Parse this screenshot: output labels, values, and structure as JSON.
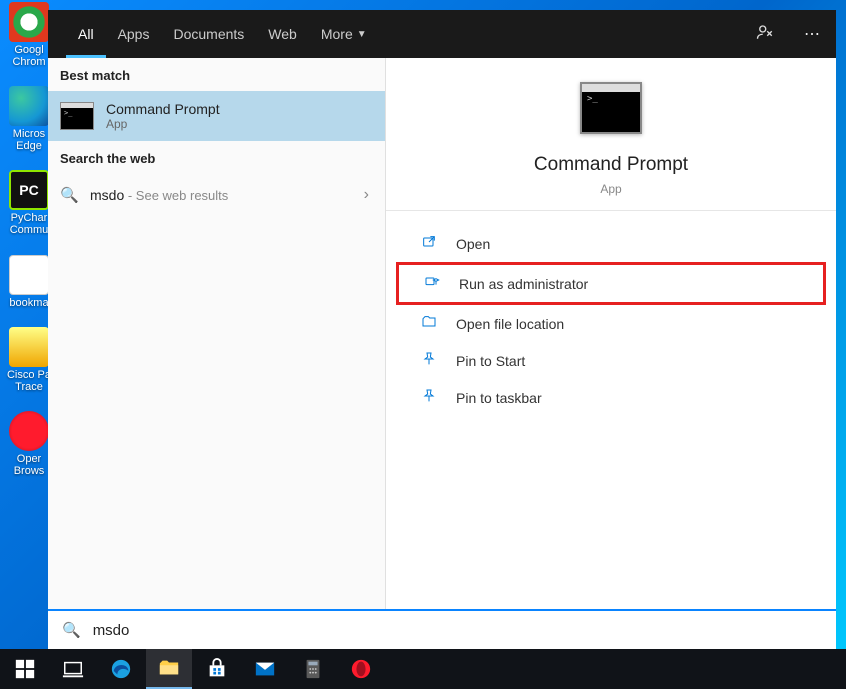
{
  "desktop_icons": [
    {
      "name": "google-chrome",
      "label": "Googl\nChrom",
      "color": "#2aa84a"
    },
    {
      "name": "ms-edge",
      "label": "Micros\nEdge",
      "color": "#1ba1e2"
    },
    {
      "name": "pycharm",
      "label": "PyChar\nCommu",
      "color": "#111",
      "text": "PC"
    },
    {
      "name": "bookmarks",
      "label": "bookma",
      "color": "#fff"
    },
    {
      "name": "cisco",
      "label": "Cisco Pa\nTrace",
      "color": "#f0c400"
    },
    {
      "name": "opera",
      "label": "Oper\nBrows",
      "color": "#ff1b2d"
    }
  ],
  "tabs": {
    "all": "All",
    "apps": "Apps",
    "documents": "Documents",
    "web": "Web",
    "more": "More"
  },
  "left": {
    "best_match": "Best match",
    "result_title": "Command Prompt",
    "result_sub": "App",
    "search_web": "Search the web",
    "web_query": "msdo",
    "web_hint": " - See web results"
  },
  "right": {
    "title": "Command Prompt",
    "sub": "App",
    "actions": {
      "open": "Open",
      "runas": "Run as administrator",
      "loc": "Open file location",
      "pinstart": "Pin to Start",
      "pintb": "Pin to taskbar"
    }
  },
  "search_value": "msdo"
}
